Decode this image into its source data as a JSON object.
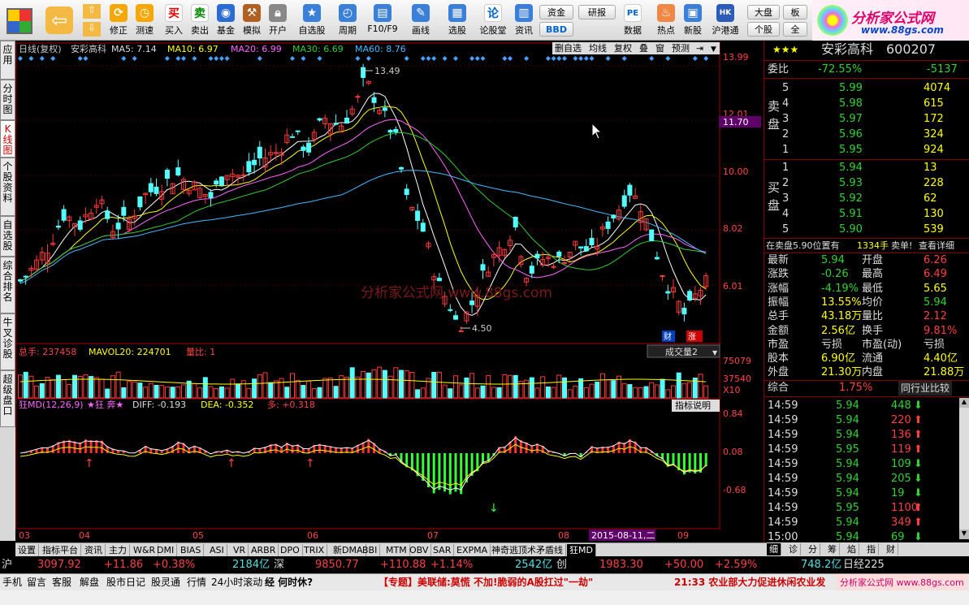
{
  "toolbar": {
    "buttons": [
      "修正",
      "测速",
      "买入",
      "卖出",
      "基金",
      "模拟",
      "开户",
      "自选股",
      "周期",
      "F10/F9",
      "画线",
      "选股",
      "论股堂",
      "资讯",
      "数据",
      "热点",
      "新股",
      "沪港通"
    ],
    "small": [
      "资金",
      "BBD",
      "研报",
      "大盘",
      "个股",
      "板",
      "全"
    ]
  },
  "logo": {
    "title": "分析家公式网",
    "url": "www.88gs.com"
  },
  "left_tabs": [
    "应用",
    "分时图",
    "K线图",
    "个股资料",
    "自选股",
    "综合排名",
    "牛叉诊股",
    "超级盘口"
  ],
  "chart_header": {
    "label": "日线(复权)",
    "stock": "安彩高科",
    "ma5": "MA5: 7.14",
    "ma10": "MA10: 6.97",
    "ma20": "MA20: 6.99",
    "ma30": "MA30: 6.69",
    "ma60": "MA60: 8.76"
  },
  "chart_buttons": [
    "删自选",
    "均线",
    "复权",
    "叠",
    "窗",
    "预测"
  ],
  "price_axis": [
    "13.99",
    "12.01",
    "11.70",
    "10.00",
    "8.02",
    "6.01"
  ],
  "annotations": {
    "high": "13.49",
    "low": "4.50",
    "cai": "财",
    "zhang": "涨"
  },
  "watermark": "分析家公式网 www.88gs.com",
  "volume": {
    "header": "总手: 237458",
    "mavol": "MAVOL20: 224701",
    "liangbi": "量比: 1",
    "select": "成交量2",
    "axis": [
      "75079",
      "37540",
      "X10"
    ]
  },
  "macd": {
    "name": "狂MD(12,26,9)",
    "star": "★狂 奔★",
    "diff": "DIFF: -0.193",
    "dea": "DEA: -0.352",
    "duo": "多: +0.318",
    "button": "指标说明",
    "axis": [
      "0.84",
      "0.08",
      "-0.68"
    ]
  },
  "date_axis": [
    "03",
    "04",
    "05",
    "06",
    "07",
    "08",
    "2015-08-11,二",
    "09"
  ],
  "chart_data": {
    "type": "candlestick",
    "title": "安彩高科 日线(复权)",
    "ylim": [
      4.5,
      13.99
    ],
    "high": 13.49,
    "low": 4.5,
    "ma": {
      "MA5": 7.14,
      "MA10": 6.97,
      "MA20": 6.99,
      "MA30": 6.69,
      "MA60": 8.76
    },
    "volume_total": 237458,
    "mavol20": 224701,
    "macd": {
      "diff": -0.193,
      "dea": -0.352,
      "duo": 0.318
    }
  },
  "quote": {
    "stars": "★★★",
    "name": "安彩高科",
    "code": "600207",
    "weibi_label": "委比",
    "weibi": "-72.55%",
    "weicha": "-5137",
    "sell_label": [
      "卖",
      "盘"
    ],
    "buy_label": [
      "买",
      "盘"
    ],
    "sell": [
      [
        "5",
        "5.99",
        "4074"
      ],
      [
        "4",
        "5.98",
        "615"
      ],
      [
        "3",
        "5.97",
        "172"
      ],
      [
        "2",
        "5.96",
        "324"
      ],
      [
        "1",
        "5.95",
        "924"
      ]
    ],
    "buy": [
      [
        "1",
        "5.94",
        "13"
      ],
      [
        "2",
        "5.93",
        "228"
      ],
      [
        "3",
        "5.92",
        "62"
      ],
      [
        "4",
        "5.91",
        "130"
      ],
      [
        "5",
        "5.90",
        "539"
      ]
    ],
    "notice": "在卖盘5.90位置有",
    "notice_vol": "1334手",
    "notice_sell": "卖单!",
    "notice_detail": "查看详细",
    "stats": [
      [
        "最新",
        "5.94",
        "开盘",
        "6.26"
      ],
      [
        "涨跌",
        "-0.26",
        "最高",
        "6.49"
      ],
      [
        "涨幅",
        "-4.19%",
        "最低",
        "5.65"
      ],
      [
        "振幅",
        "13.55%",
        "均价",
        "5.94"
      ],
      [
        "总手",
        "43.18万",
        "量比",
        "2.12"
      ],
      [
        "金额",
        "2.56亿",
        "换手",
        "9.81%"
      ],
      [
        "市盈",
        "亏损",
        "市盈(动)",
        "亏损"
      ],
      [
        "股本",
        "6.90亿",
        "流通",
        "4.40亿"
      ],
      [
        "外盘",
        "21.30万",
        "内盘",
        "21.88万"
      ]
    ],
    "zonghe": "综合",
    "zonghe_pct": "1.75%",
    "compare": "同行业比较",
    "ticks": [
      [
        "14:59",
        "5.94",
        "448"
      ],
      [
        "14:59",
        "5.94",
        "220"
      ],
      [
        "14:59",
        "5.94",
        "136"
      ],
      [
        "14:59",
        "5.95",
        "119"
      ],
      [
        "14:59",
        "5.94",
        "109"
      ],
      [
        "14:59",
        "5.94",
        "205"
      ],
      [
        "14:59",
        "5.94",
        "19"
      ],
      [
        "14:59",
        "5.95",
        "1100"
      ],
      [
        "14:59",
        "5.94",
        "349"
      ],
      [
        "15:00",
        "5.94",
        "69"
      ]
    ],
    "right_tabs": [
      "细",
      "诊",
      "分",
      "筹",
      "焰",
      "指",
      "财"
    ]
  },
  "bottom_tabs": [
    "设置",
    "指标平台",
    "资讯",
    "主力",
    "W&R",
    "DMI",
    "BIAS",
    "ASI",
    "VR",
    "ARBR",
    "DPO",
    "TRIX",
    "新DMA",
    "BBI",
    "MTM",
    "OBV",
    "SAR",
    "EXPMA",
    "神奇逃顶术矛盾线",
    "狂MD"
  ],
  "index_bar": {
    "sh": "沪",
    "sh_val": "3097.92",
    "sh_chg": "+11.86",
    "sh_pct": "+0.38%",
    "sh_amt": "2184亿",
    "sz": "深",
    "sz_val": "9850.77",
    "sz_chg": "+110.88",
    "sz_pct": "+1.14%",
    "sz_amt": "2542亿",
    "cy": "创",
    "cy_val": "1983.30",
    "cy_chg": "+50.00",
    "cy_pct": "+2.59%",
    "cy_amt": "748.2亿",
    "jp": "日经225"
  },
  "status": {
    "items": [
      "手机",
      "留言",
      "客服",
      "解盘",
      "股市日记",
      "股灵通",
      "行情",
      "24小时滚动"
    ],
    "ticker1": "经 何时休?",
    "ticker2": "【专题】美联储:莫慌 不加!脆弱的A股扛过\"一劫\"",
    "ticker3": "21:33 农业部大力促进休闲农业发",
    "ad": "分析家公式网 www.88gs.com"
  }
}
